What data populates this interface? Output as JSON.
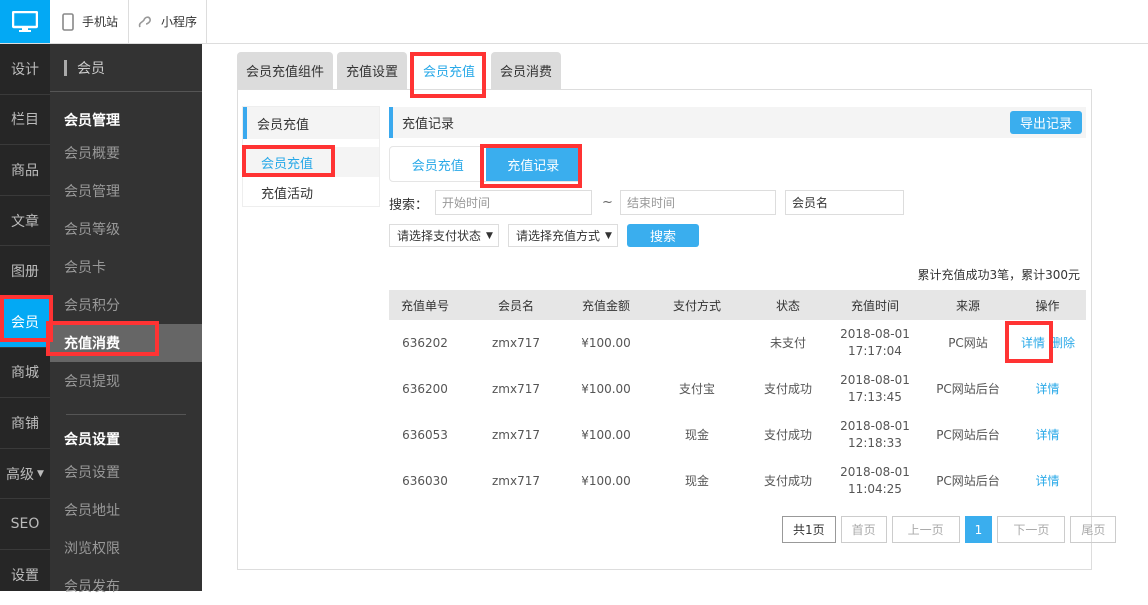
{
  "topbar": {
    "items": [
      {
        "label": "手机站",
        "icon": "mobile-icon"
      },
      {
        "label": "小程序",
        "icon": "mini-program-icon"
      }
    ]
  },
  "leftnav": {
    "items": [
      "设计",
      "栏目",
      "商品",
      "文章",
      "图册",
      "会员",
      "商城",
      "商铺",
      "高级",
      "SEO",
      "设置"
    ],
    "active": "会员"
  },
  "subnav": {
    "title": "会员",
    "groups": [
      {
        "title": "会员管理",
        "links": [
          "会员概要",
          "会员管理",
          "会员等级",
          "会员卡",
          "会员积分",
          "充值消费",
          "会员提现"
        ]
      },
      {
        "title": "会员设置",
        "links": [
          "会员设置",
          "会员地址",
          "浏览权限",
          "会员发布"
        ]
      }
    ],
    "active": "充值消费"
  },
  "tabs": [
    "会员充值组件",
    "充值设置",
    "会员充值",
    "会员消费"
  ],
  "active_tab": "会员充值",
  "left_menu": {
    "title": "会员充值",
    "items": [
      "会员充值",
      "充值活动"
    ]
  },
  "section": {
    "title": "充值记录",
    "export_label": "导出记录"
  },
  "subtabs": [
    "会员充值",
    "充值记录"
  ],
  "search": {
    "label": "搜索：",
    "start_placeholder": "开始时间",
    "separator": "~",
    "end_placeholder": "结束时间",
    "member_placeholder": "会员名",
    "pay_status": "请选择支付状态",
    "pay_method": "请选择充值方式",
    "button": "搜索"
  },
  "summary": "累计充值成功3笔，累计300元",
  "table": {
    "headers": [
      "充值单号",
      "会员名",
      "充值金额",
      "支付方式",
      "状态",
      "充值时间",
      "来源",
      "操作"
    ],
    "rows": [
      {
        "id": "636202",
        "member": "zmx717",
        "amount": "¥100.00",
        "method": "",
        "status": "未支付",
        "date": "2018-08-01",
        "time": "17:17:04",
        "source": "PC网站",
        "actions": [
          "详情",
          "删除"
        ]
      },
      {
        "id": "636200",
        "member": "zmx717",
        "amount": "¥100.00",
        "method": "支付宝",
        "status": "支付成功",
        "date": "2018-08-01",
        "time": "17:13:45",
        "source": "PC网站后台",
        "actions": [
          "详情"
        ]
      },
      {
        "id": "636053",
        "member": "zmx717",
        "amount": "¥100.00",
        "method": "现金",
        "status": "支付成功",
        "date": "2018-08-01",
        "time": "12:18:33",
        "source": "PC网站后台",
        "actions": [
          "详情"
        ]
      },
      {
        "id": "636030",
        "member": "zmx717",
        "amount": "¥100.00",
        "method": "现金",
        "status": "支付成功",
        "date": "2018-08-01",
        "time": "11:04:25",
        "source": "PC网站后台",
        "actions": [
          "详情"
        ]
      }
    ]
  },
  "pager": {
    "total": "共1页",
    "first": "首页",
    "prev": "上一页",
    "current": "1",
    "next": "下一页",
    "last": "尾页"
  },
  "colors": {
    "accent": "#03a9f4",
    "button": "#3aaeee",
    "highlight": "#ff3333"
  }
}
